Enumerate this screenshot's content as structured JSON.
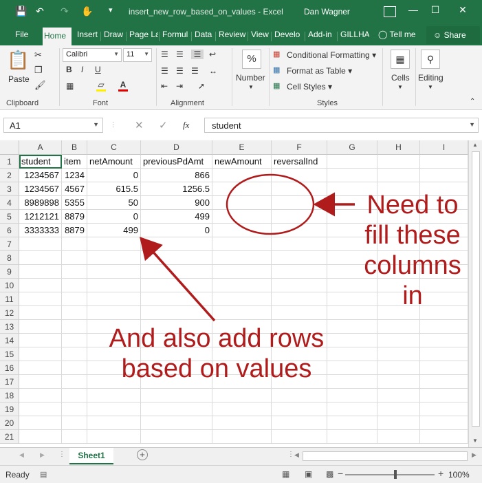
{
  "window": {
    "title": "insert_new_row_based_on_values - Excel",
    "user": "Dan Wagner"
  },
  "tabs": [
    "File",
    "Home",
    "Insert",
    "Draw",
    "Page La",
    "Formul",
    "Data",
    "Review",
    "View",
    "Develo",
    "Add-in",
    "GILLHA",
    "Tell me"
  ],
  "share_label": "Share",
  "ribbon": {
    "clipboard": {
      "paste": "Paste",
      "label": "Clipboard"
    },
    "font": {
      "name": "Calibri",
      "size": "11",
      "label": "Font"
    },
    "alignment": {
      "label": "Alignment"
    },
    "number": {
      "button": "Number",
      "symbol": "%"
    },
    "styles": {
      "conditional": "Conditional Formatting",
      "format_table": "Format as Table",
      "cell_styles": "Cell Styles",
      "label": "Styles"
    },
    "cells": {
      "button": "Cells"
    },
    "editing": {
      "button": "Editing"
    }
  },
  "formula_bar": {
    "name_box": "A1",
    "fx_label": "fx",
    "content": "student"
  },
  "grid": {
    "columns": [
      "A",
      "B",
      "C",
      "D",
      "E",
      "F",
      "G",
      "H",
      "I"
    ],
    "row_numbers": [
      "1",
      "2",
      "3",
      "4",
      "5",
      "6",
      "7",
      "8",
      "9",
      "10",
      "11",
      "12",
      "13",
      "14",
      "15",
      "16",
      "17",
      "18",
      "19",
      "20",
      "21"
    ],
    "rows": [
      [
        "student",
        "item",
        "netAmount",
        "previousPdAmt",
        "newAmount",
        "reversalInd"
      ],
      [
        "1234567",
        "1234",
        "0",
        "866",
        "",
        ""
      ],
      [
        "1234567",
        "4567",
        "615.5",
        "1256.5",
        "",
        ""
      ],
      [
        "8989898",
        "5355",
        "50",
        "900",
        "",
        ""
      ],
      [
        "1212121",
        "8879",
        "0",
        "499",
        "",
        ""
      ],
      [
        "3333333",
        "8879",
        "499",
        "0",
        "",
        ""
      ]
    ]
  },
  "annotations": {
    "right_note": [
      "Need to",
      "fill these",
      "columns",
      "in"
    ],
    "bottom_note": [
      "And also add rows",
      "based on values"
    ],
    "color": "#b01c1c"
  },
  "sheet_tab": "Sheet1",
  "status": {
    "ready": "Ready",
    "zoom": "100%"
  },
  "colors": {
    "excel_green": "#217346"
  }
}
